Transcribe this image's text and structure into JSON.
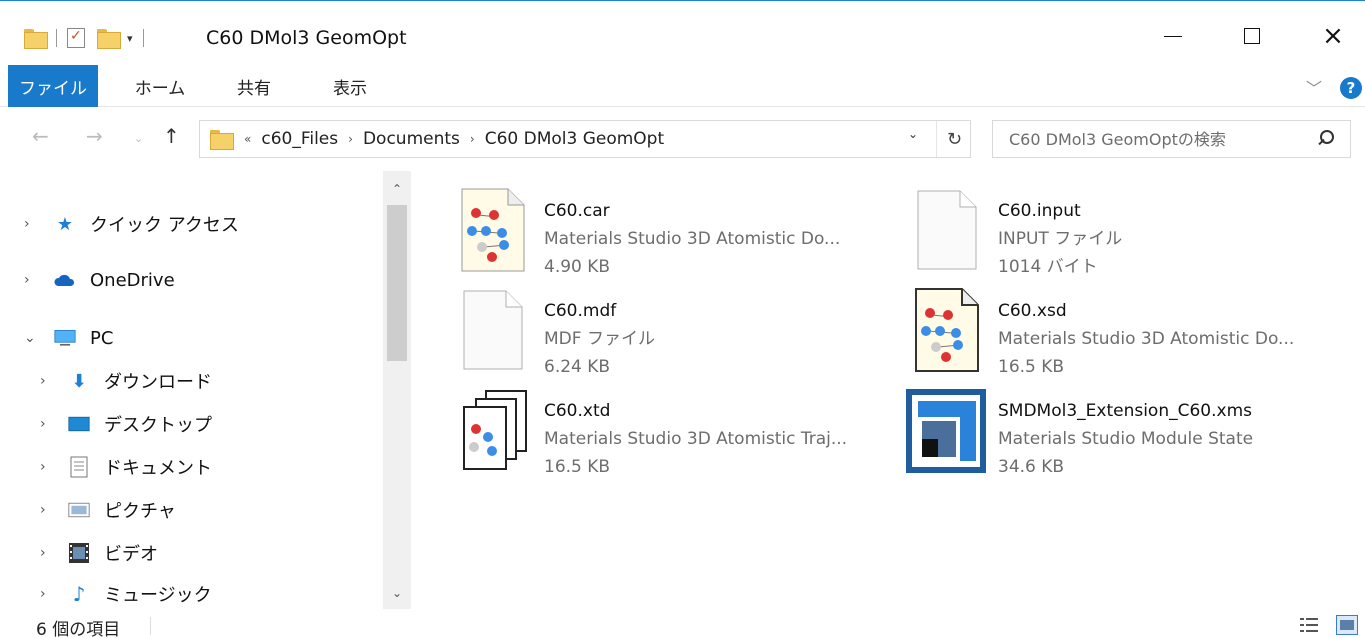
{
  "window": {
    "title": "C60 DMol3 GeomOpt"
  },
  "ribbon": {
    "tabs": [
      "ファイル",
      "ホーム",
      "共有",
      "表示"
    ]
  },
  "address": {
    "overflow": "«",
    "crumbs": [
      "c60_Files",
      "Documents",
      "C60 DMol3 GeomOpt"
    ]
  },
  "search": {
    "placeholder": "C60 DMol3 GeomOptの検索"
  },
  "nav": {
    "items": [
      {
        "label": "クイック アクセス",
        "icon": "star-icon"
      },
      {
        "label": "OneDrive",
        "icon": "cloud-icon"
      },
      {
        "label": "PC",
        "icon": "monitor-icon"
      },
      {
        "label": "ダウンロード",
        "icon": "download-arrow-icon"
      },
      {
        "label": "デスクトップ",
        "icon": "desktop-icon"
      },
      {
        "label": "ドキュメント",
        "icon": "document-icon"
      },
      {
        "label": "ピクチャ",
        "icon": "picture-icon"
      },
      {
        "label": "ビデオ",
        "icon": "video-icon"
      },
      {
        "label": "ミュージック",
        "icon": "music-note-icon"
      }
    ]
  },
  "files": [
    {
      "name": "C60.car",
      "type": "Materials Studio 3D Atomistic Do...",
      "size": "4.90 KB",
      "icon": "atomistic-document-icon"
    },
    {
      "name": "C60.input",
      "type": "INPUT ファイル",
      "size": "1014 バイト",
      "icon": "blank-file-icon"
    },
    {
      "name": "C60.mdf",
      "type": "MDF ファイル",
      "size": "6.24 KB",
      "icon": "blank-file-icon"
    },
    {
      "name": "C60.xsd",
      "type": "Materials Studio 3D Atomistic Do...",
      "size": "16.5 KB",
      "icon": "atomistic-document-icon"
    },
    {
      "name": "C60.xtd",
      "type": "Materials Studio 3D Atomistic Traj...",
      "size": "16.5 KB",
      "icon": "atomistic-trajectory-icon"
    },
    {
      "name": "SMDMol3_Extension_C60.xms",
      "type": "Materials Studio Module State",
      "size": "34.6 KB",
      "icon": "module-state-icon"
    }
  ],
  "status": {
    "count_text": "6 個の項目"
  },
  "colors": {
    "accent": "#1979ca",
    "folder": "#f6d16a",
    "module_blue": "#2b82d9"
  }
}
